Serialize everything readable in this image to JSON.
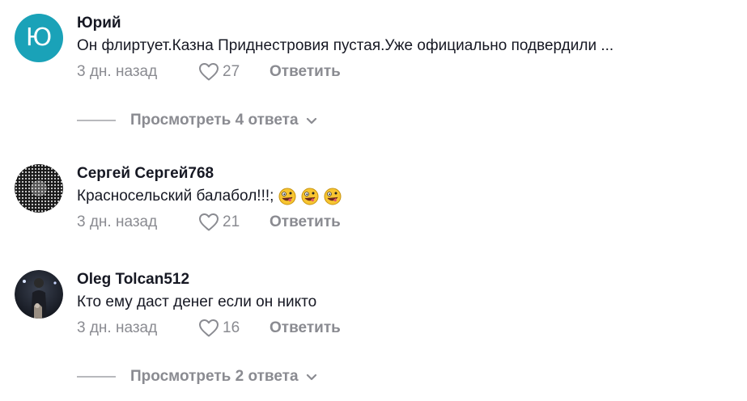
{
  "comments": [
    {
      "avatar_letter": "Ю",
      "author": "Юрий",
      "text": "Он флиртует.Казна Приднестровия пустая.Уже официально подвердили ...",
      "date": "3 дн. назад",
      "likes": "27",
      "reply_label": "Ответить",
      "view_replies": "Просмотреть 4 ответа",
      "icons": [
        "heart-outline-icon",
        "chevron-down-icon"
      ]
    },
    {
      "author": "Сергей Сергей768",
      "text": "Красносельский балабол!!!;",
      "emoji": [
        "zany-face-emoji",
        "zany-face-emoji",
        "zany-face-emoji"
      ],
      "date": "3 дн. назад",
      "likes": "21",
      "reply_label": "Ответить"
    },
    {
      "author": "Oleg Tolcan512",
      "text": "Кто ему даст денег если он никто",
      "date": "3 дн. назад",
      "likes": "16",
      "reply_label": "Ответить",
      "view_replies": "Просмотреть 2 ответа"
    }
  ],
  "colors": {
    "avatar_bg": "#1aa2b8",
    "text": "#161823",
    "muted": "#8a8b91"
  }
}
